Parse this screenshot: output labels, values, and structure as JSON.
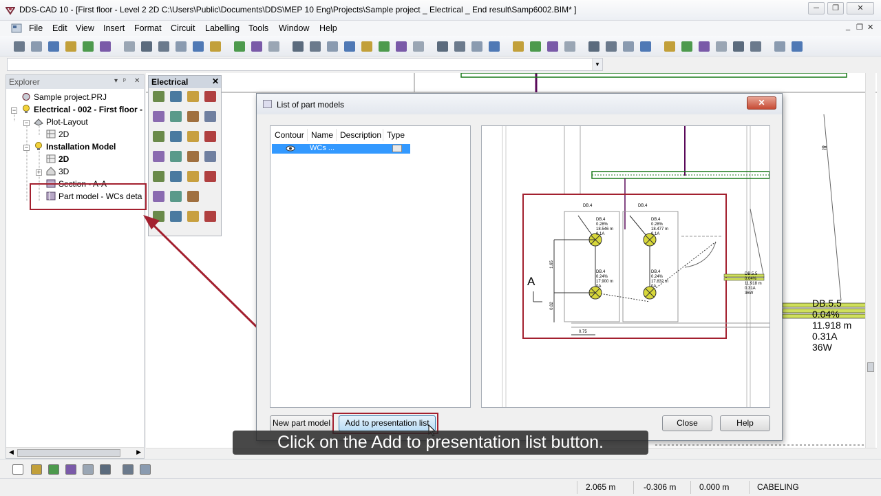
{
  "window": {
    "title": "DDS-CAD 10 - [First floor - Level 2  2D  C:\\Users\\Public\\Documents\\DDS\\MEP 10 Eng\\Projects\\Sample project _ Electrical _ End result\\Samp6002.BIM* ]",
    "minimize": "─",
    "restore": "❐",
    "close": "✕"
  },
  "menu": {
    "items": [
      "File",
      "Edit",
      "View",
      "Insert",
      "Format",
      "Circuit",
      "Labelling",
      "Tools",
      "Window",
      "Help"
    ],
    "mdi_minimize": "_",
    "mdi_restore": "❐",
    "mdi_close": "✕"
  },
  "explorer": {
    "title": "Explorer",
    "pin": "ᵖ",
    "close": "✕",
    "tree": [
      {
        "label": "Sample project.PRJ",
        "bold": false
      },
      {
        "label": "Electrical - 002 - First floor -",
        "bold": true
      },
      {
        "label": "Plot-Layout",
        "bold": false
      },
      {
        "label": "2D",
        "bold": false
      },
      {
        "label": "Installation Model",
        "bold": true
      },
      {
        "label": "2D",
        "bold": true
      },
      {
        "label": "3D",
        "bold": false
      },
      {
        "label": "Section - A-A",
        "bold": false
      },
      {
        "label": "Part model - WCs deta",
        "bold": false
      }
    ]
  },
  "palette": {
    "title": "Electrical",
    "close": "✕"
  },
  "dialog": {
    "title": "List of part models",
    "close": "✕",
    "columns": [
      "Contour",
      "Name",
      "Description",
      "Type"
    ],
    "rows": [
      {
        "name": "WCs ..."
      }
    ],
    "buttons": {
      "new_part_model": "New part model",
      "add_to_presentation": "Add to presentation list",
      "close": "Close",
      "help": "Help"
    }
  },
  "preview": {
    "section_label": "A",
    "db_top_left": "DB.4",
    "db_top_right": "DB.4",
    "lamp1": [
      "DB.4",
      "0.28%",
      "18.546 m",
      "0.1A"
    ],
    "lamp2": [
      "DB.4",
      "0.28%",
      "18.477 m",
      "0.1A"
    ],
    "lamp3": [
      "DB.4",
      "0.24%",
      "17.900 m",
      "0A"
    ],
    "lamp4": [
      "DB.4",
      "0.24%",
      "17.832 m",
      "0A"
    ],
    "dim_vertical1": "1.65",
    "dim_vertical2": "0.82",
    "dim_horizontal": "0.75",
    "db55_small": [
      "DB.5.5",
      "0.04%",
      "11.918 m",
      "0.31A",
      "36W"
    ]
  },
  "cad_label": {
    "lines": [
      "DB.5.5",
      "0.04%",
      "11.918 m",
      "0.31A",
      "36W"
    ]
  },
  "caption": "Click on the Add to presentation list button.",
  "status": {
    "x": "2.065 m",
    "y": "-0.306 m",
    "z": "0.000 m",
    "mode": "CABELING"
  },
  "colors": {
    "highlight": "#a3202f",
    "selection": "#3399ff",
    "cable_green": "#1a7a1a",
    "cable_purple": "#5a0a5a",
    "lamp_yellow": "#d8d83a"
  }
}
